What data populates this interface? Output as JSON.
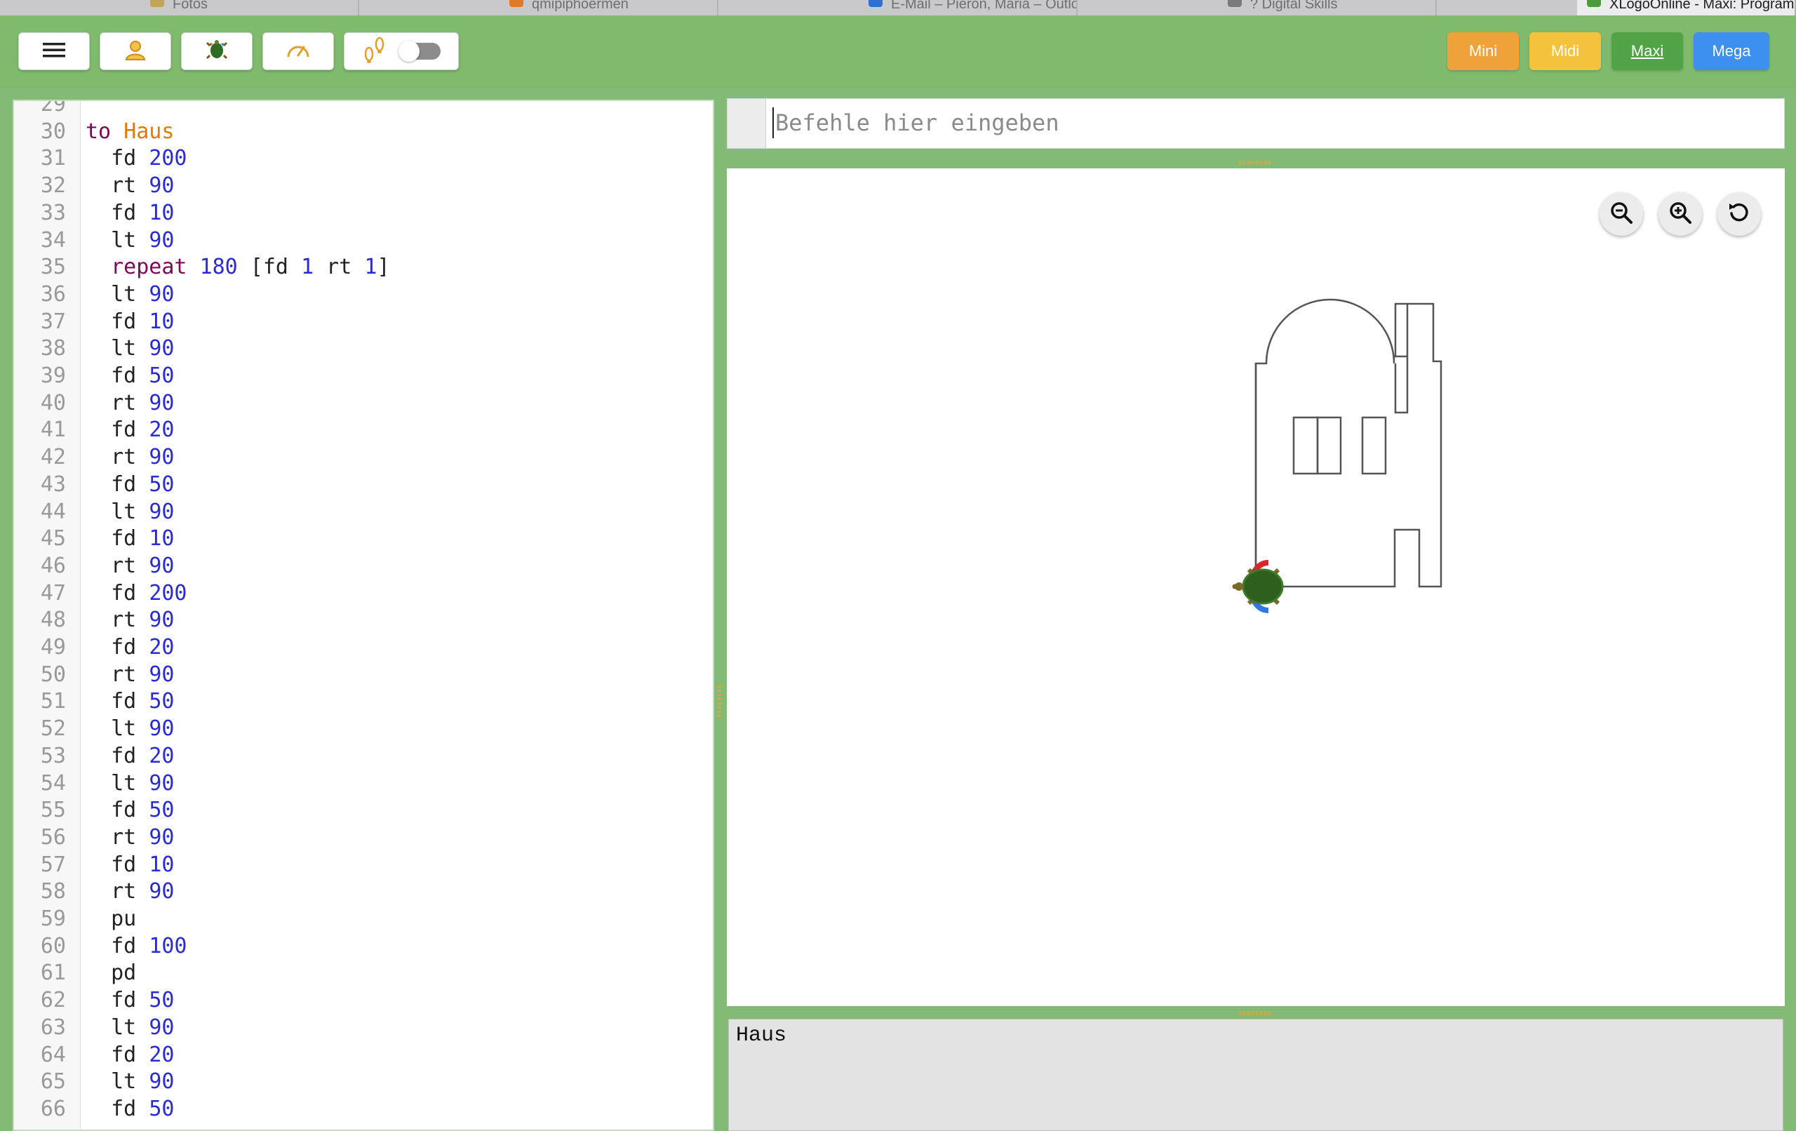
{
  "browser_tabs": [
    {
      "label": "Fotos",
      "favicon_color": "#c4a35a"
    },
    {
      "label": "qmipiphoermen",
      "favicon_color": "#e07a2b"
    },
    {
      "label": "E-Mail – Pieron, Maria – Outlook",
      "favicon_color": "#2f6fd0"
    },
    {
      "label": "? Digital Skills",
      "favicon_color": "#7a7a7a"
    },
    {
      "label": "XLogoOnline - Maxi: Programmieren an all",
      "favicon_color": "#4c9a3c"
    }
  ],
  "toolbar": {
    "icons": [
      "menu-icon",
      "user-icon",
      "turtle-icon",
      "speedometer-icon",
      "footsteps-icon"
    ],
    "toggle_on": false,
    "levels": [
      {
        "label": "Mini",
        "color": "#f0a23a",
        "active": false
      },
      {
        "label": "Midi",
        "color": "#f4c23c",
        "active": false
      },
      {
        "label": "Maxi",
        "color": "#52a347",
        "active": true
      },
      {
        "label": "Mega",
        "color": "#3d8ff0",
        "active": false
      }
    ]
  },
  "editor": {
    "lines": [
      {
        "n": "29",
        "tokens": []
      },
      {
        "n": "30",
        "tokens": [
          {
            "t": "to",
            "c": "kw"
          },
          {
            "t": " "
          },
          {
            "t": "Haus",
            "c": "nm"
          }
        ]
      },
      {
        "n": "31",
        "tokens": [
          {
            "t": "  fd "
          },
          {
            "t": "200",
            "c": "num"
          }
        ]
      },
      {
        "n": "32",
        "tokens": [
          {
            "t": "  rt "
          },
          {
            "t": "90",
            "c": "num"
          }
        ]
      },
      {
        "n": "33",
        "tokens": [
          {
            "t": "  fd "
          },
          {
            "t": "10",
            "c": "num"
          }
        ]
      },
      {
        "n": "34",
        "tokens": [
          {
            "t": "  lt "
          },
          {
            "t": "90",
            "c": "num"
          }
        ]
      },
      {
        "n": "35",
        "tokens": [
          {
            "t": "  "
          },
          {
            "t": "repeat",
            "c": "kw"
          },
          {
            "t": " "
          },
          {
            "t": "180",
            "c": "num"
          },
          {
            "t": " ["
          },
          {
            "t": "fd "
          },
          {
            "t": "1",
            "c": "num"
          },
          {
            "t": " rt "
          },
          {
            "t": "1",
            "c": "num"
          },
          {
            "t": "]"
          }
        ]
      },
      {
        "n": "36",
        "tokens": [
          {
            "t": "  lt "
          },
          {
            "t": "90",
            "c": "num"
          }
        ]
      },
      {
        "n": "37",
        "tokens": [
          {
            "t": "  fd "
          },
          {
            "t": "10",
            "c": "num"
          }
        ]
      },
      {
        "n": "38",
        "tokens": [
          {
            "t": "  lt "
          },
          {
            "t": "90",
            "c": "num"
          }
        ]
      },
      {
        "n": "39",
        "tokens": [
          {
            "t": "  fd "
          },
          {
            "t": "50",
            "c": "num"
          }
        ]
      },
      {
        "n": "40",
        "tokens": [
          {
            "t": "  rt "
          },
          {
            "t": "90",
            "c": "num"
          }
        ]
      },
      {
        "n": "41",
        "tokens": [
          {
            "t": "  fd "
          },
          {
            "t": "20",
            "c": "num"
          }
        ]
      },
      {
        "n": "42",
        "tokens": [
          {
            "t": "  rt "
          },
          {
            "t": "90",
            "c": "num"
          }
        ]
      },
      {
        "n": "43",
        "tokens": [
          {
            "t": "  fd "
          },
          {
            "t": "50",
            "c": "num"
          }
        ]
      },
      {
        "n": "44",
        "tokens": [
          {
            "t": "  lt "
          },
          {
            "t": "90",
            "c": "num"
          }
        ]
      },
      {
        "n": "45",
        "tokens": [
          {
            "t": "  fd "
          },
          {
            "t": "10",
            "c": "num"
          }
        ]
      },
      {
        "n": "46",
        "tokens": [
          {
            "t": "  rt "
          },
          {
            "t": "90",
            "c": "num"
          }
        ]
      },
      {
        "n": "47",
        "tokens": [
          {
            "t": "  fd "
          },
          {
            "t": "200",
            "c": "num"
          }
        ]
      },
      {
        "n": "48",
        "tokens": [
          {
            "t": "  rt "
          },
          {
            "t": "90",
            "c": "num"
          }
        ]
      },
      {
        "n": "49",
        "tokens": [
          {
            "t": "  fd "
          },
          {
            "t": "20",
            "c": "num"
          }
        ]
      },
      {
        "n": "50",
        "tokens": [
          {
            "t": "  rt "
          },
          {
            "t": "90",
            "c": "num"
          }
        ]
      },
      {
        "n": "51",
        "tokens": [
          {
            "t": "  fd "
          },
          {
            "t": "50",
            "c": "num"
          }
        ]
      },
      {
        "n": "52",
        "tokens": [
          {
            "t": "  lt "
          },
          {
            "t": "90",
            "c": "num"
          }
        ]
      },
      {
        "n": "53",
        "tokens": [
          {
            "t": "  fd "
          },
          {
            "t": "20",
            "c": "num"
          }
        ]
      },
      {
        "n": "54",
        "tokens": [
          {
            "t": "  lt "
          },
          {
            "t": "90",
            "c": "num"
          }
        ]
      },
      {
        "n": "55",
        "tokens": [
          {
            "t": "  fd "
          },
          {
            "t": "50",
            "c": "num"
          }
        ]
      },
      {
        "n": "56",
        "tokens": [
          {
            "t": "  rt "
          },
          {
            "t": "90",
            "c": "num"
          }
        ]
      },
      {
        "n": "57",
        "tokens": [
          {
            "t": "  fd "
          },
          {
            "t": "10",
            "c": "num"
          }
        ]
      },
      {
        "n": "58",
        "tokens": [
          {
            "t": "  rt "
          },
          {
            "t": "90",
            "c": "num"
          }
        ]
      },
      {
        "n": "59",
        "tokens": [
          {
            "t": "  pu"
          }
        ]
      },
      {
        "n": "60",
        "tokens": [
          {
            "t": "  fd "
          },
          {
            "t": "100",
            "c": "num"
          }
        ]
      },
      {
        "n": "61",
        "tokens": [
          {
            "t": "  pd"
          }
        ]
      },
      {
        "n": "62",
        "tokens": [
          {
            "t": "  fd "
          },
          {
            "t": "50",
            "c": "num"
          }
        ]
      },
      {
        "n": "63",
        "tokens": [
          {
            "t": "  lt "
          },
          {
            "t": "90",
            "c": "num"
          }
        ]
      },
      {
        "n": "64",
        "tokens": [
          {
            "t": "  fd "
          },
          {
            "t": "20",
            "c": "num"
          }
        ]
      },
      {
        "n": "65",
        "tokens": [
          {
            "t": "  lt "
          },
          {
            "t": "90",
            "c": "num"
          }
        ]
      },
      {
        "n": "66",
        "tokens": [
          {
            "t": "  fd "
          },
          {
            "t": "50",
            "c": "num"
          }
        ]
      }
    ]
  },
  "command": {
    "placeholder": "Befehle hier eingeben",
    "value": ""
  },
  "canvas": {
    "zoom_buttons": [
      "zoom-out-icon",
      "zoom-in-icon",
      "reset-icon"
    ]
  },
  "output": {
    "text": "Haus"
  }
}
